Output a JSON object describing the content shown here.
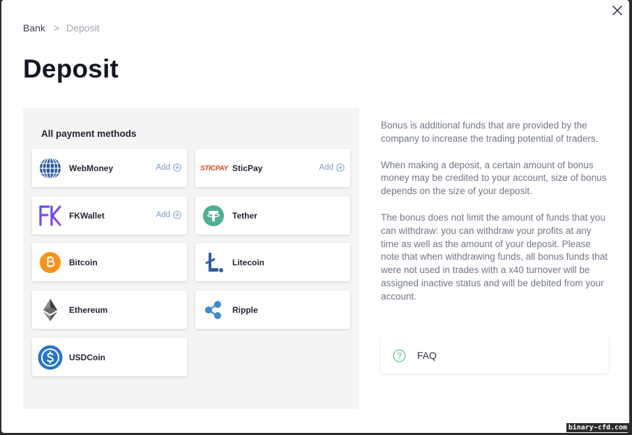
{
  "breadcrumb": {
    "root": "Bank",
    "separator": ">",
    "current": "Deposit"
  },
  "page_title": "Deposit",
  "panel_title": "All payment methods",
  "methods": [
    {
      "name": "WebMoney",
      "add": "Add",
      "icon": "webmoney-icon"
    },
    {
      "name": "SticPay",
      "add": "Add",
      "icon": "sticpay-icon",
      "logo_text": "STICPAY"
    },
    {
      "name": "FKWallet",
      "add": "Add",
      "icon": "fkwallet-icon"
    },
    {
      "name": "Tether",
      "icon": "tether-icon"
    },
    {
      "name": "Bitcoin",
      "icon": "bitcoin-icon"
    },
    {
      "name": "Litecoin",
      "icon": "litecoin-icon"
    },
    {
      "name": "Ethereum",
      "icon": "ethereum-icon"
    },
    {
      "name": "Ripple",
      "icon": "ripple-icon"
    },
    {
      "name": "USDCoin",
      "icon": "usdcoin-icon"
    }
  ],
  "info": {
    "p1": "Bonus is additional funds that are provided by the company to increase the trading potential of traders.",
    "p2": "When making a deposit, a certain amount of bonus money may be credited to your account, size of bonus depends on the size of your deposit.",
    "p3": "The bonus does not limit the amount of funds that you can withdraw: you can withdraw your profits at any time as well as the amount of your deposit. Please note that when withdrawing funds, all bonus funds that were not used in trades with a x40 turnover will be assigned inactive status and will be debited from your account."
  },
  "faq": {
    "label": "FAQ"
  },
  "watermark": "binary-cfd.com",
  "colors": {
    "accent_blue": "#7a9cc9",
    "faq_green": "#5fc48a",
    "tether": "#50af95",
    "bitcoin": "#f7931a",
    "litecoin": "#345d9d",
    "usdcoin": "#2775ca",
    "webmoney": "#2c5a9e",
    "sticpay": "#e0471e",
    "fkwallet": "#7b3ff2"
  }
}
